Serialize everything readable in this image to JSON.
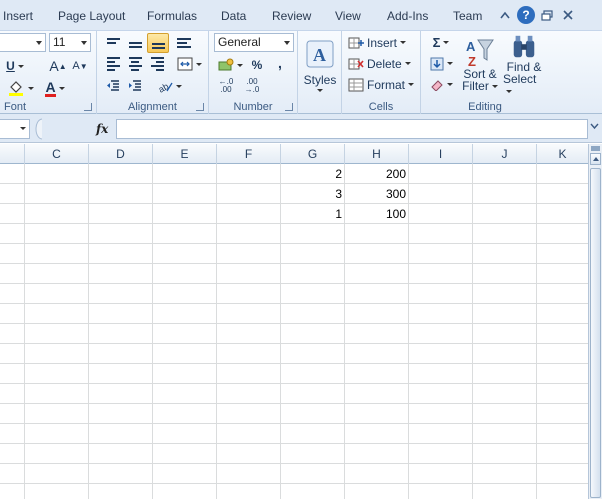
{
  "menu": {
    "tabs": [
      "Insert",
      "Page Layout",
      "Formulas",
      "Data",
      "Review",
      "View",
      "Add-Ins",
      "Team"
    ],
    "help_glyph": "?",
    "controls": [
      "collapse-ribbon-icon",
      "help-icon",
      "restore-icon",
      "close-icon"
    ]
  },
  "ribbon": {
    "font": {
      "label": "Font",
      "size_value": "11",
      "underline": "U",
      "grow": "A",
      "shrink": "A",
      "font_color_glyph": "A"
    },
    "alignment": {
      "label": "Alignment"
    },
    "number": {
      "label": "Number",
      "format_value": "General",
      "percent": "%",
      "comma": ",",
      "inc_decimal": "←.0\n.00",
      "dec_decimal": ".00\n→.0"
    },
    "styles": {
      "label": "Styles"
    },
    "cells": {
      "label": "Cells",
      "insert": "Insert",
      "delete": "Delete",
      "format": "Format"
    },
    "editing": {
      "label": "Editing",
      "sigma": "Σ",
      "sort_line1": "Sort &",
      "sort_line2": "Filter",
      "find_line1": "Find &",
      "find_line2": "Select"
    }
  },
  "formula_bar": {
    "fx": "fx",
    "value": ""
  },
  "sheet": {
    "columns": [
      "C",
      "D",
      "E",
      "F",
      "G",
      "H",
      "I",
      "J",
      "K"
    ],
    "rows": [
      {
        "G": "2",
        "H": "200"
      },
      {
        "G": "3",
        "H": "300"
      },
      {
        "G": "1",
        "H": "100"
      }
    ]
  },
  "colors": {
    "tab_bg": "#dfe9f5",
    "gridline": "#dadcdd",
    "active_accent": "#f7c95a",
    "help_blue": "#2e6dbe"
  }
}
